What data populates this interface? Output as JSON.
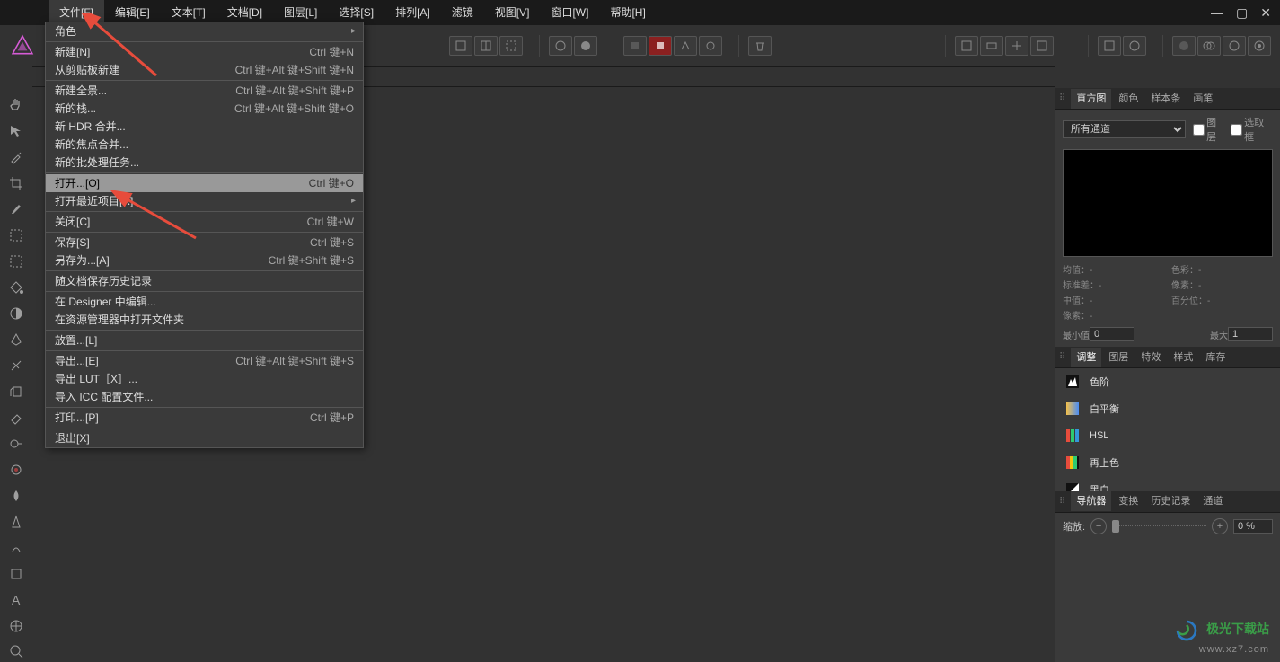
{
  "menubar": {
    "items": [
      {
        "label": "文件[F]",
        "active": true
      },
      {
        "label": "编辑[E]"
      },
      {
        "label": "文本[T]"
      },
      {
        "label": "文档[D]"
      },
      {
        "label": "图层[L]"
      },
      {
        "label": "选择[S]"
      },
      {
        "label": "排列[A]"
      },
      {
        "label": "滤镜"
      },
      {
        "label": "视图[V]"
      },
      {
        "label": "窗口[W]"
      },
      {
        "label": "帮助[H]"
      }
    ]
  },
  "dropdown": {
    "groups": [
      [
        {
          "label": "角色",
          "submenu": true
        }
      ],
      [
        {
          "label": "新建[N]",
          "shortcut": "Ctrl 键+N"
        },
        {
          "label": "从剪贴板新建",
          "shortcut": "Ctrl 键+Alt 键+Shift 键+N"
        }
      ],
      [
        {
          "label": "新建全景...",
          "shortcut": "Ctrl 键+Alt 键+Shift 键+P"
        },
        {
          "label": "新的栈...",
          "shortcut": "Ctrl 键+Alt 键+Shift 键+O"
        },
        {
          "label": "新 HDR 合并..."
        },
        {
          "label": "新的焦点合并..."
        },
        {
          "label": "新的批处理任务..."
        }
      ],
      [
        {
          "label": "打开...[O]",
          "shortcut": "Ctrl 键+O",
          "highlighted": true
        },
        {
          "label": "打开最近项目[R]",
          "submenu": true
        }
      ],
      [
        {
          "label": "关闭[C]",
          "shortcut": "Ctrl 键+W"
        }
      ],
      [
        {
          "label": "保存[S]",
          "shortcut": "Ctrl 键+S"
        },
        {
          "label": "另存为...[A]",
          "shortcut": "Ctrl 键+Shift 键+S"
        }
      ],
      [
        {
          "label": "随文档保存历史记录"
        }
      ],
      [
        {
          "label": "在 Designer 中编辑..."
        },
        {
          "label": "在资源管理器中打开文件夹"
        }
      ],
      [
        {
          "label": "放置...[L]"
        }
      ],
      [
        {
          "label": "导出...[E]",
          "shortcut": "Ctrl 键+Alt 键+Shift 键+S"
        },
        {
          "label": "导出 LUT［X］..."
        },
        {
          "label": "导入 ICC 配置文件..."
        }
      ],
      [
        {
          "label": "打印...[P]",
          "shortcut": "Ctrl 键+P"
        }
      ],
      [
        {
          "label": "退出[X]"
        }
      ]
    ]
  },
  "panels": {
    "histogram": {
      "tabs": [
        "直方图",
        "颜色",
        "样本条",
        "画笔"
      ],
      "active_tab": 0,
      "channel_select": "所有通道",
      "check_layer": "图层",
      "check_selection": "选取框",
      "stats": {
        "mean_label": "均值：-",
        "color_label": "色彩：-",
        "stddev_label": "标准差：-",
        "px_label": "像素：-",
        "median_label": "中值：-",
        "pct_label": "百分位：-",
        "pixels_label": "像素：-"
      },
      "min_label": "最小值",
      "min_value": "0",
      "max_label": "最大",
      "max_value": "1"
    },
    "adjust": {
      "tabs": [
        "调整",
        "图层",
        "特效",
        "样式",
        "库存"
      ],
      "active_tab": 0,
      "items": [
        {
          "label": "色阶",
          "icon": "levels"
        },
        {
          "label": "白平衡",
          "icon": "wb"
        },
        {
          "label": "HSL",
          "icon": "hsl"
        },
        {
          "label": "再上色",
          "icon": "recolor"
        },
        {
          "label": "黑白",
          "icon": "bw"
        }
      ]
    },
    "navigator": {
      "tabs": [
        "导航器",
        "变换",
        "历史记录",
        "通道"
      ],
      "active_tab": 0,
      "zoom_label": "缩放:",
      "zoom_value": "0 %"
    }
  },
  "watermark": {
    "text": "极光下载站",
    "url": "www.xz7.com"
  }
}
